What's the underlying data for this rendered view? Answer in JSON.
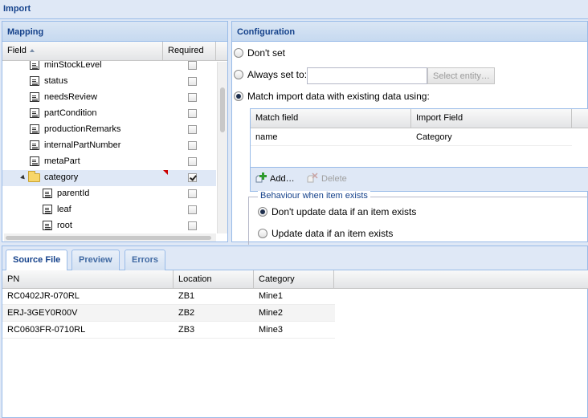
{
  "window": {
    "title": "Import"
  },
  "mapping": {
    "title": "Mapping",
    "columns": {
      "field": "Field",
      "required": "Required"
    },
    "rows": [
      {
        "label": "minStockLevel",
        "required": false
      },
      {
        "label": "status",
        "required": false
      },
      {
        "label": "needsReview",
        "required": false
      },
      {
        "label": "partCondition",
        "required": false
      },
      {
        "label": "productionRemarks",
        "required": false
      },
      {
        "label": "internalPartNumber",
        "required": false
      },
      {
        "label": "metaPart",
        "required": false
      },
      {
        "label": "category",
        "required": true,
        "type": "folder",
        "expanded": true
      },
      {
        "label": "parentId",
        "required": false,
        "indent": 1
      },
      {
        "label": "leaf",
        "required": false,
        "indent": 1
      },
      {
        "label": "root",
        "required": false,
        "indent": 1
      }
    ]
  },
  "config": {
    "title": "Configuration",
    "options": {
      "dont_set": "Don't set",
      "always_set": "Always set to:",
      "match": "Match import data with existing data using:"
    },
    "selected_option": "match",
    "always_set_value": "",
    "select_entity_label": "Select entity…",
    "match_grid": {
      "columns": {
        "match_field": "Match field",
        "import_field": "Import Field"
      },
      "rows": [
        {
          "match_field": "name",
          "import_field": "Category"
        }
      ],
      "add_label": "Add…",
      "delete_label": "Delete"
    },
    "behaviour": {
      "legend": "Behaviour when item exists",
      "dont_update": "Don't update data if an item exists",
      "update": "Update data if an item exists",
      "selected": "dont_update"
    }
  },
  "source": {
    "tabs": [
      "Source File",
      "Preview",
      "Errors"
    ],
    "active_tab": "Source File",
    "columns": [
      "PN",
      "Location",
      "Category"
    ],
    "rows": [
      {
        "pn": "RC0402JR-070RL",
        "location": "ZB1",
        "category": "Mine1"
      },
      {
        "pn": "ERJ-3GEY0R00V",
        "location": "ZB2",
        "category": "Mine2"
      },
      {
        "pn": "RC0603FR-0710RL",
        "location": "ZB3",
        "category": "Mine3"
      }
    ]
  },
  "colors": {
    "accent": "#15428b",
    "border": "#99bbe8",
    "panel_bg": "#dfe8f6",
    "dirty_flag": "#cc0000"
  }
}
